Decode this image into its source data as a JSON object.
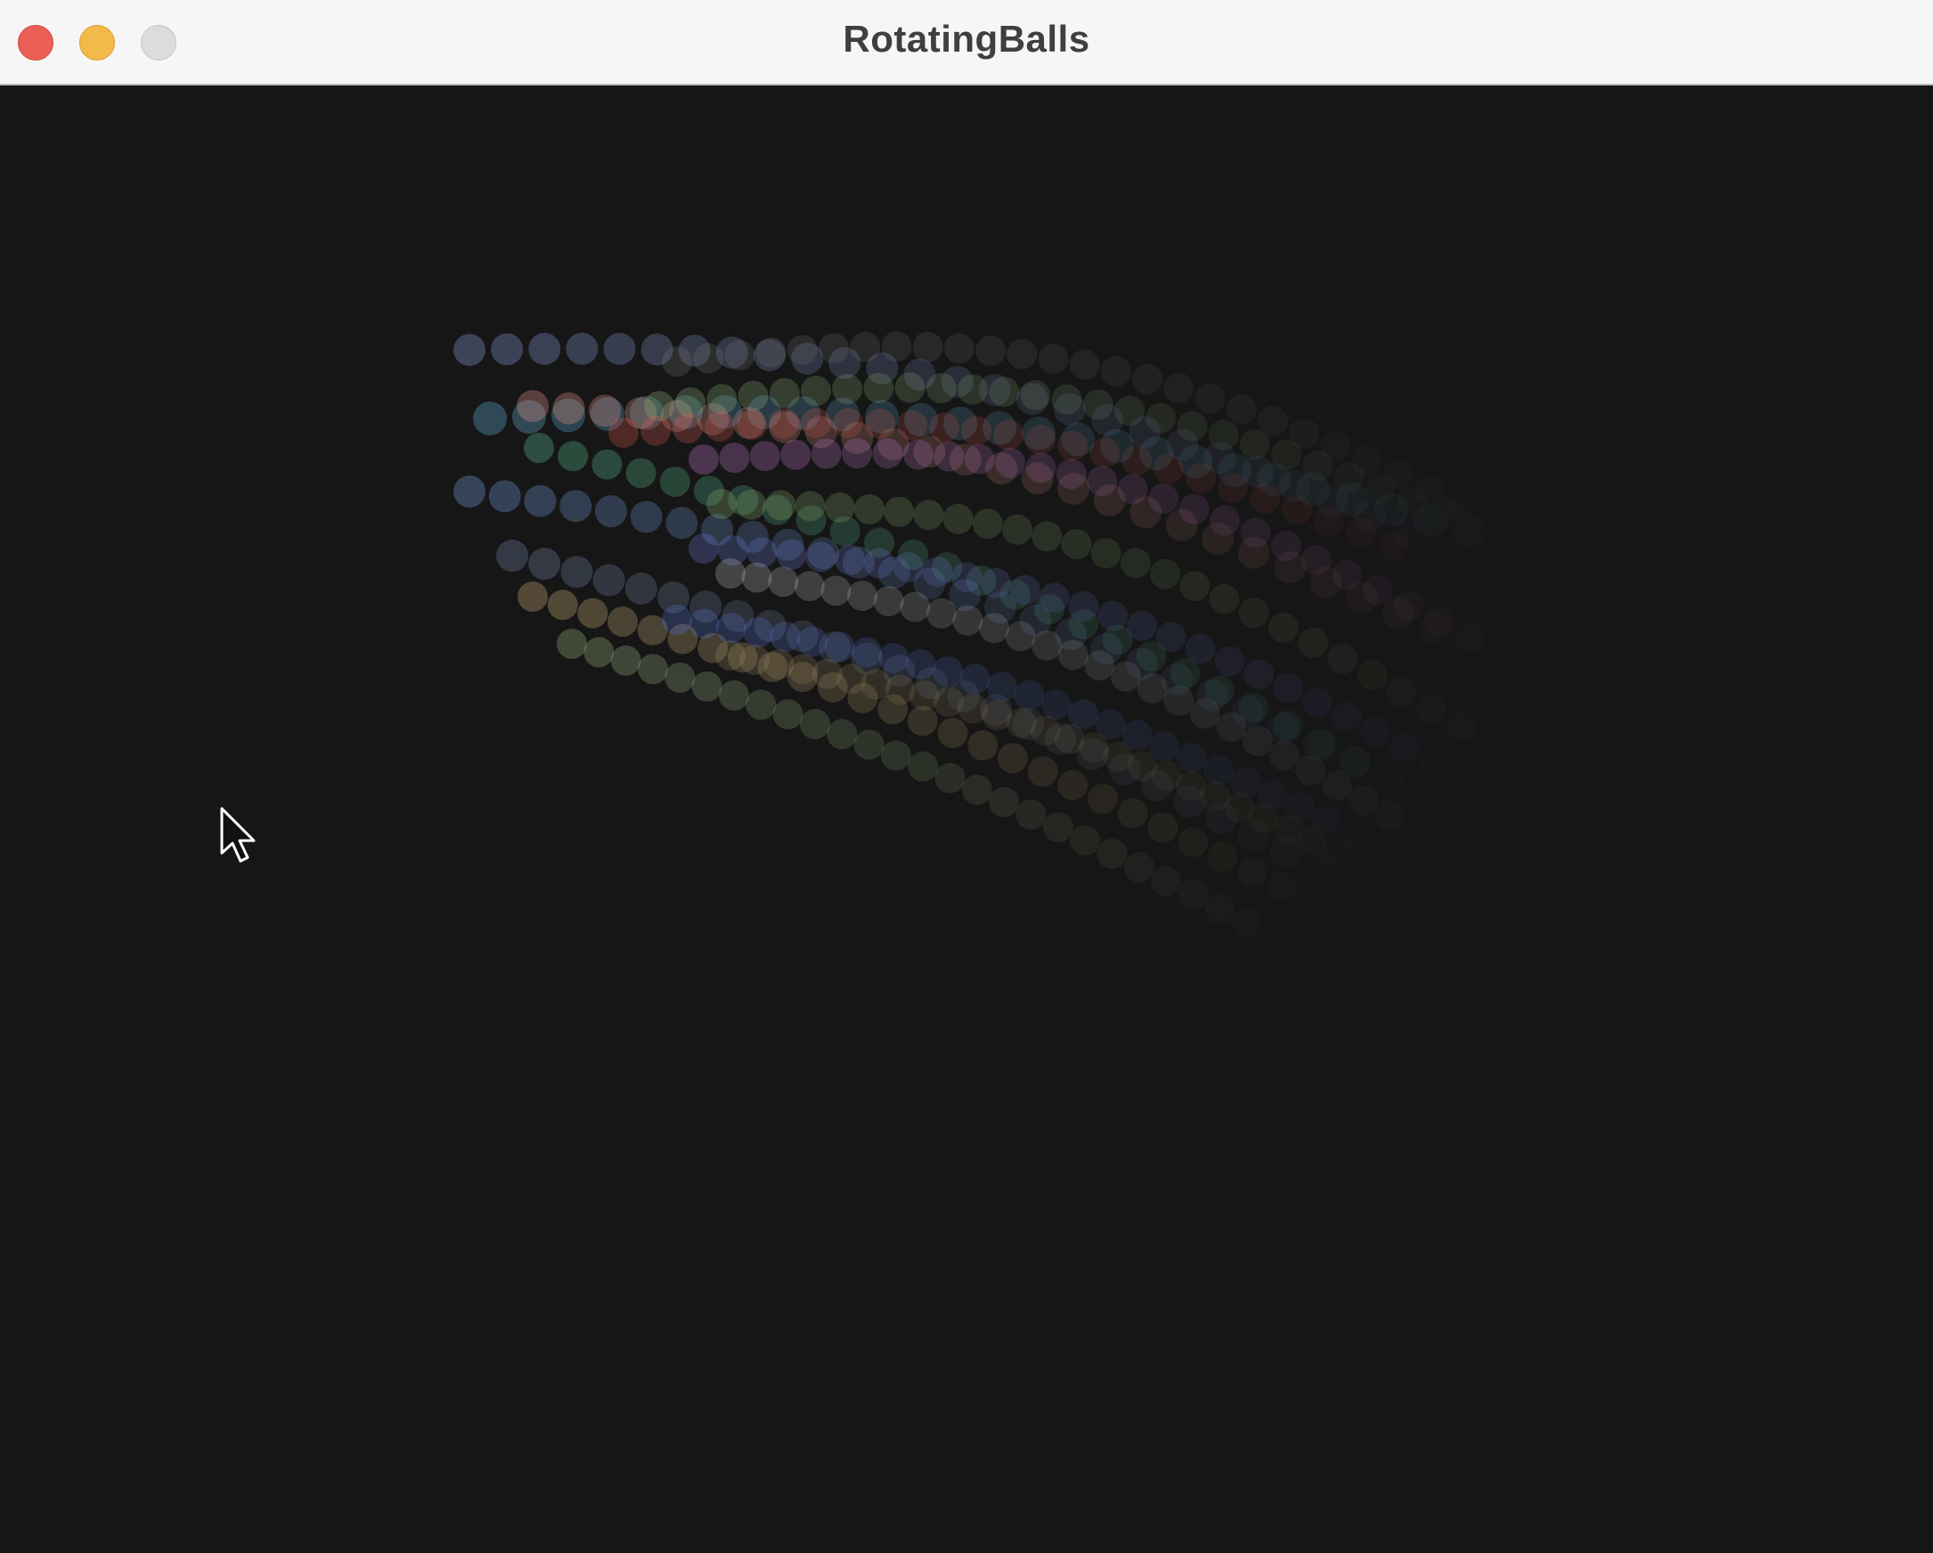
{
  "window": {
    "title": "RotatingBalls"
  },
  "colors": {
    "titlebar_bg": "#f7f6f6",
    "canvas_bg": "#161616",
    "close": "#ec5f57",
    "minimize": "#f3b949",
    "zoom": "#dcdcdc"
  },
  "icons": {
    "close": "close-traffic-light",
    "minimize": "minimize-traffic-light",
    "zoom": "zoom-traffic-light",
    "cursor": "arrow-cursor-icon"
  }
}
